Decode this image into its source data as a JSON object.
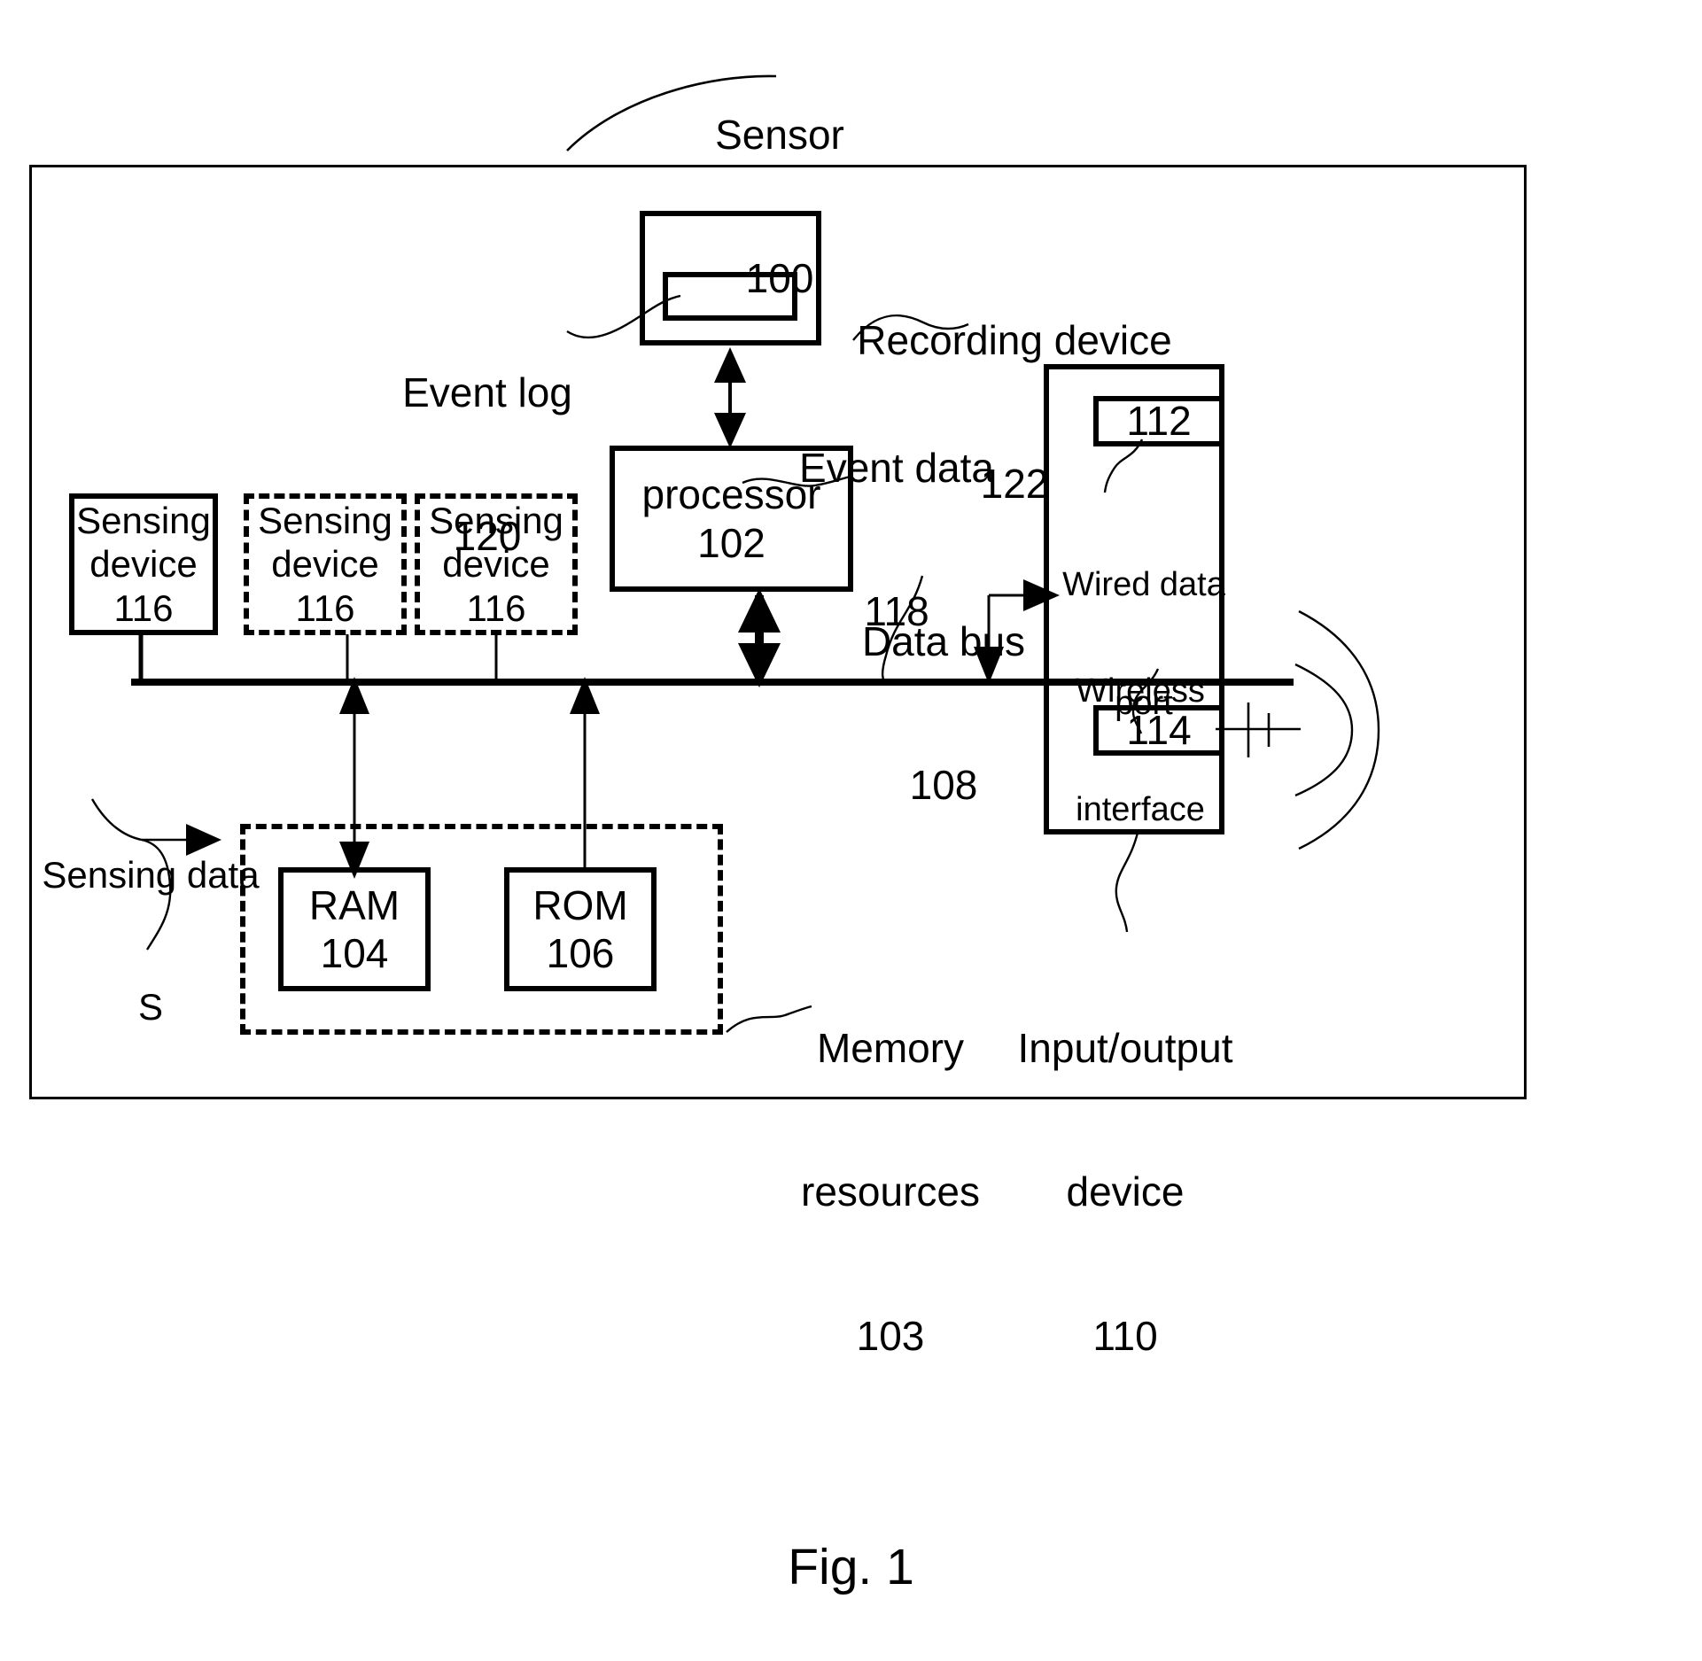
{
  "figure": {
    "caption": "Fig. 1",
    "title_callout": {
      "line1": "Sensor",
      "line2": "100"
    }
  },
  "callouts": {
    "event_log": {
      "line1": "Event log",
      "line2": "120"
    },
    "recording_device": {
      "line1": "Recording device",
      "line2": "122"
    },
    "event_data": {
      "line1": "Event data",
      "line2": "118"
    },
    "data_bus": {
      "line1": "Data bus",
      "line2": "108"
    },
    "sensing_data": {
      "line1": "Sensing data",
      "line2": "S"
    },
    "memory_resources": {
      "line1": "Memory",
      "line2": "resources",
      "line3": "103"
    },
    "io_device": {
      "line1": "Input/output",
      "line2": "device",
      "line3": "110"
    },
    "wired_data_port": {
      "line1": "Wired data",
      "line2": "port"
    },
    "wireless_interface": {
      "line1": "Wireless",
      "line2": "interface"
    }
  },
  "blocks": {
    "recording_device": {
      "ref": "122"
    },
    "event_log": {
      "ref": "120"
    },
    "processor": {
      "label": "processor",
      "ref": "102"
    },
    "sensing_devices": [
      {
        "line1": "Sensing",
        "line2": "device",
        "ref": "116",
        "style": "solid"
      },
      {
        "line1": "Sensing",
        "line2": "device",
        "ref": "116",
        "style": "dashed"
      },
      {
        "line1": "Sensing",
        "line2": "device",
        "ref": "116",
        "style": "dashed"
      }
    ],
    "ram": {
      "label": "RAM",
      "ref": "104"
    },
    "rom": {
      "label": "ROM",
      "ref": "106"
    },
    "io_device": {
      "wired_port_ref": "112",
      "wireless_ref": "114"
    }
  },
  "colors": {
    "ink": "#000000",
    "paper": "#ffffff"
  }
}
